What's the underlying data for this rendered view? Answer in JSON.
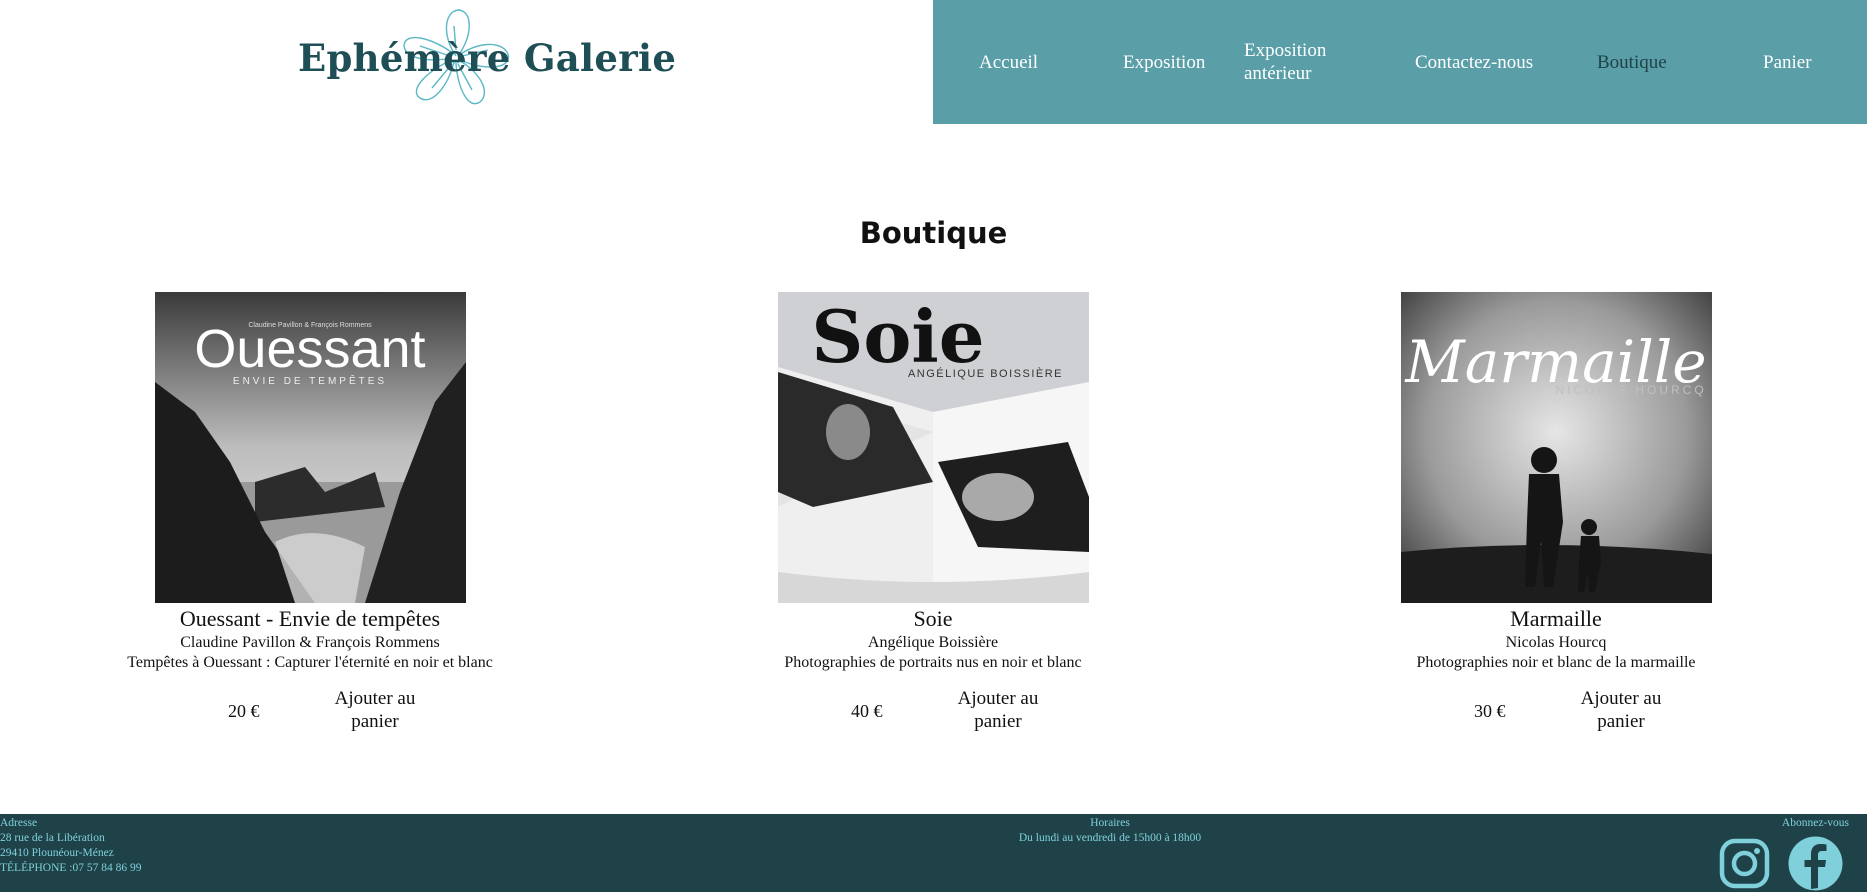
{
  "brand": {
    "name": "Ephémère Galerie"
  },
  "nav": {
    "items": [
      {
        "label": "Accueil"
      },
      {
        "label": "Exposition"
      },
      {
        "label": "Exposition antérieur"
      },
      {
        "label": "Contactez-nous"
      },
      {
        "label": "Boutique",
        "active": true
      },
      {
        "label": "Panier"
      }
    ]
  },
  "page": {
    "title": "Boutique"
  },
  "products": [
    {
      "title": "Ouessant - Envie de tempêtes",
      "author": "Claudine Pavillon & François Rommens",
      "description": "Tempêtes à Ouessant : Capturer l'éternité en noir et blanc",
      "price": "20 €",
      "add_label": "Ajouter au panier",
      "cover": {
        "headline": "Ouessant",
        "subtitle": "ENVIE DE TEMPÊTES",
        "credit": "Claudine Pavillon & François Rommens"
      }
    },
    {
      "title": "Soie",
      "author": "Angélique Boissière",
      "description": "Photographies de portraits nus en noir et blanc",
      "price": "40 €",
      "add_label": "Ajouter au panier",
      "cover": {
        "headline": "Soie",
        "subtitle": "ANGÉLIQUE BOISSIÈRE"
      }
    },
    {
      "title": "Marmaille",
      "author": "Nicolas Hourcq",
      "description": "Photographies noir et blanc de la marmaille",
      "price": "30 €",
      "add_label": "Ajouter au panier",
      "cover": {
        "headline": "Marmaille",
        "subtitle": "NICOLAS HOURCQ"
      }
    }
  ],
  "footer": {
    "address_label": "Adresse",
    "address_line1": "28 rue de la Libération",
    "address_line2": "29410 Plounéour-Ménez",
    "phone": "TÉLÉPHONE :07 57 84 86 99",
    "hours_label": "Horaires",
    "hours_text": "Du lundi au vendredi de 15h00 à 18h00",
    "social_label": "Abonnez-vous",
    "icons": [
      "instagram-icon",
      "facebook-icon"
    ]
  },
  "colors": {
    "nav_bg": "#5a9ea7",
    "footer_bg": "#1f4249",
    "footer_text": "#7fd0da",
    "brand_text": "#1f4f56"
  }
}
